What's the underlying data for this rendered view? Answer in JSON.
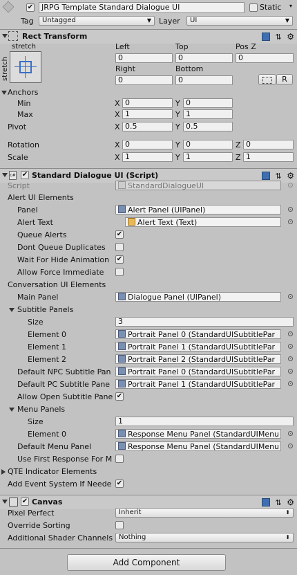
{
  "gameobject": {
    "active": true,
    "name": "JRPG Template Standard Dialogue UI",
    "static_label": "Static",
    "static_checked": false,
    "tag_label": "Tag",
    "tag_value": "Untagged",
    "layer_label": "Layer",
    "layer_value": "UI"
  },
  "rect_transform": {
    "title": "Rect Transform",
    "stretch_top": "stretch",
    "stretch_side": "stretch",
    "left_label": "Left",
    "left_value": "0",
    "top_label": "Top",
    "top_value": "0",
    "posz_label": "Pos Z",
    "posz_value": "0",
    "right_label": "Right",
    "right_value": "0",
    "bottom_label": "Bottom",
    "bottom_value": "0",
    "r_button": "R",
    "anchors_label": "Anchors",
    "min_label": "Min",
    "min_x": "0",
    "min_y": "0",
    "max_label": "Max",
    "max_x": "1",
    "max_y": "1",
    "pivot_label": "Pivot",
    "pivot_x": "0.5",
    "pivot_y": "0.5",
    "rotation_label": "Rotation",
    "rot_x": "0",
    "rot_y": "0",
    "rot_z": "0",
    "scale_label": "Scale",
    "scale_x": "1",
    "scale_y": "1",
    "scale_z": "1",
    "x": "X",
    "y": "Y",
    "z": "Z"
  },
  "script": {
    "title": "Standard Dialogue UI (Script)",
    "script_label": "Script",
    "script_value": "StandardDialogueUI",
    "alert_section": "Alert UI Elements",
    "panel_label": "Panel",
    "panel_value": "Alert Panel (UIPanel)",
    "alert_text_label": "Alert Text",
    "alert_text_value": "Alert Text (Text)",
    "queue_alerts_label": "Queue Alerts",
    "queue_alerts": true,
    "dont_queue_label": "Dont Queue Duplicates",
    "dont_queue": false,
    "wait_hide_label": "Wait For Hide Animation",
    "wait_hide": true,
    "allow_force_label": "Allow Force Immediate",
    "allow_force": false,
    "conversation_section": "Conversation UI Elements",
    "main_panel_label": "Main Panel",
    "main_panel_value": "Dialogue Panel (UIPanel)",
    "subtitle_panels_label": "Subtitle Panels",
    "size_label": "Size",
    "subtitle_size": "3",
    "element0_label": "Element 0",
    "element0_value": "Portrait Panel 0 (StandardUISubtitlePar",
    "element1_label": "Element 1",
    "element1_value": "Portrait Panel 1 (StandardUISubtitlePar",
    "element2_label": "Element 2",
    "element2_value": "Portrait Panel 2 (StandardUISubtitlePar",
    "default_npc_label": "Default NPC Subtitle Pan",
    "default_npc_value": "Portrait Panel 0 (StandardUISubtitlePar",
    "default_pc_label": "Default PC Subtitle Pane",
    "default_pc_value": "Portrait Panel 1 (StandardUISubtitlePar",
    "allow_open_label": "Allow Open Subtitle Pane",
    "allow_open": true,
    "menu_panels_label": "Menu Panels",
    "menu_size": "1",
    "menu_element0_label": "Element 0",
    "menu_element0_value": "Response Menu Panel (StandardUIMenu",
    "default_menu_label": "Default Menu Panel",
    "default_menu_value": "Response Menu Panel (StandardUIMenu",
    "use_first_label": "Use First Response For M",
    "use_first": false,
    "qte_section": "QTE Indicator Elements",
    "add_event_label": "Add Event System If Neede",
    "add_event": true
  },
  "canvas": {
    "title": "Canvas",
    "pixel_perfect_label": "Pixel Perfect",
    "pixel_perfect_value": "Inherit",
    "override_label": "Override Sorting",
    "override": false,
    "shader_label": "Additional Shader Channels",
    "shader_value": "Nothing"
  },
  "add_component": "Add Component"
}
